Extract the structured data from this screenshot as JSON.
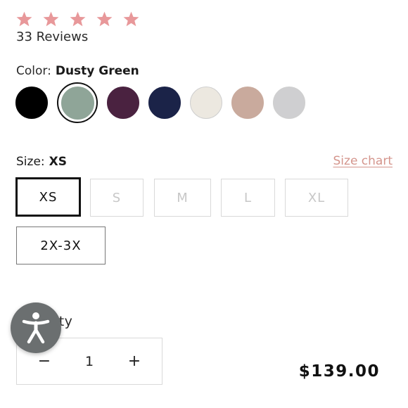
{
  "rating": {
    "stars": 5,
    "star_color": "#e8989a",
    "reviews_label": "33 Reviews"
  },
  "color": {
    "label": "Color:",
    "selected": "Dusty Green",
    "swatches": [
      {
        "name": "black",
        "hex": "#000000"
      },
      {
        "name": "dusty-green",
        "hex": "#8fa598"
      },
      {
        "name": "plum",
        "hex": "#4a2240"
      },
      {
        "name": "navy",
        "hex": "#1b2348"
      },
      {
        "name": "ivory",
        "hex": "#ece8e0"
      },
      {
        "name": "blush",
        "hex": "#c9aa9d"
      },
      {
        "name": "light-gray",
        "hex": "#cfcfd1"
      }
    ]
  },
  "size": {
    "label": "Size:",
    "selected": "XS",
    "chart_link": "Size chart",
    "options": [
      "XS",
      "S",
      "M",
      "L",
      "XL",
      "2X-3X"
    ]
  },
  "quantity": {
    "label_visible": "tity",
    "minus": "−",
    "value": "1",
    "plus": "+"
  },
  "price": "$139.00",
  "accessibility_button": "accessibility-icon"
}
